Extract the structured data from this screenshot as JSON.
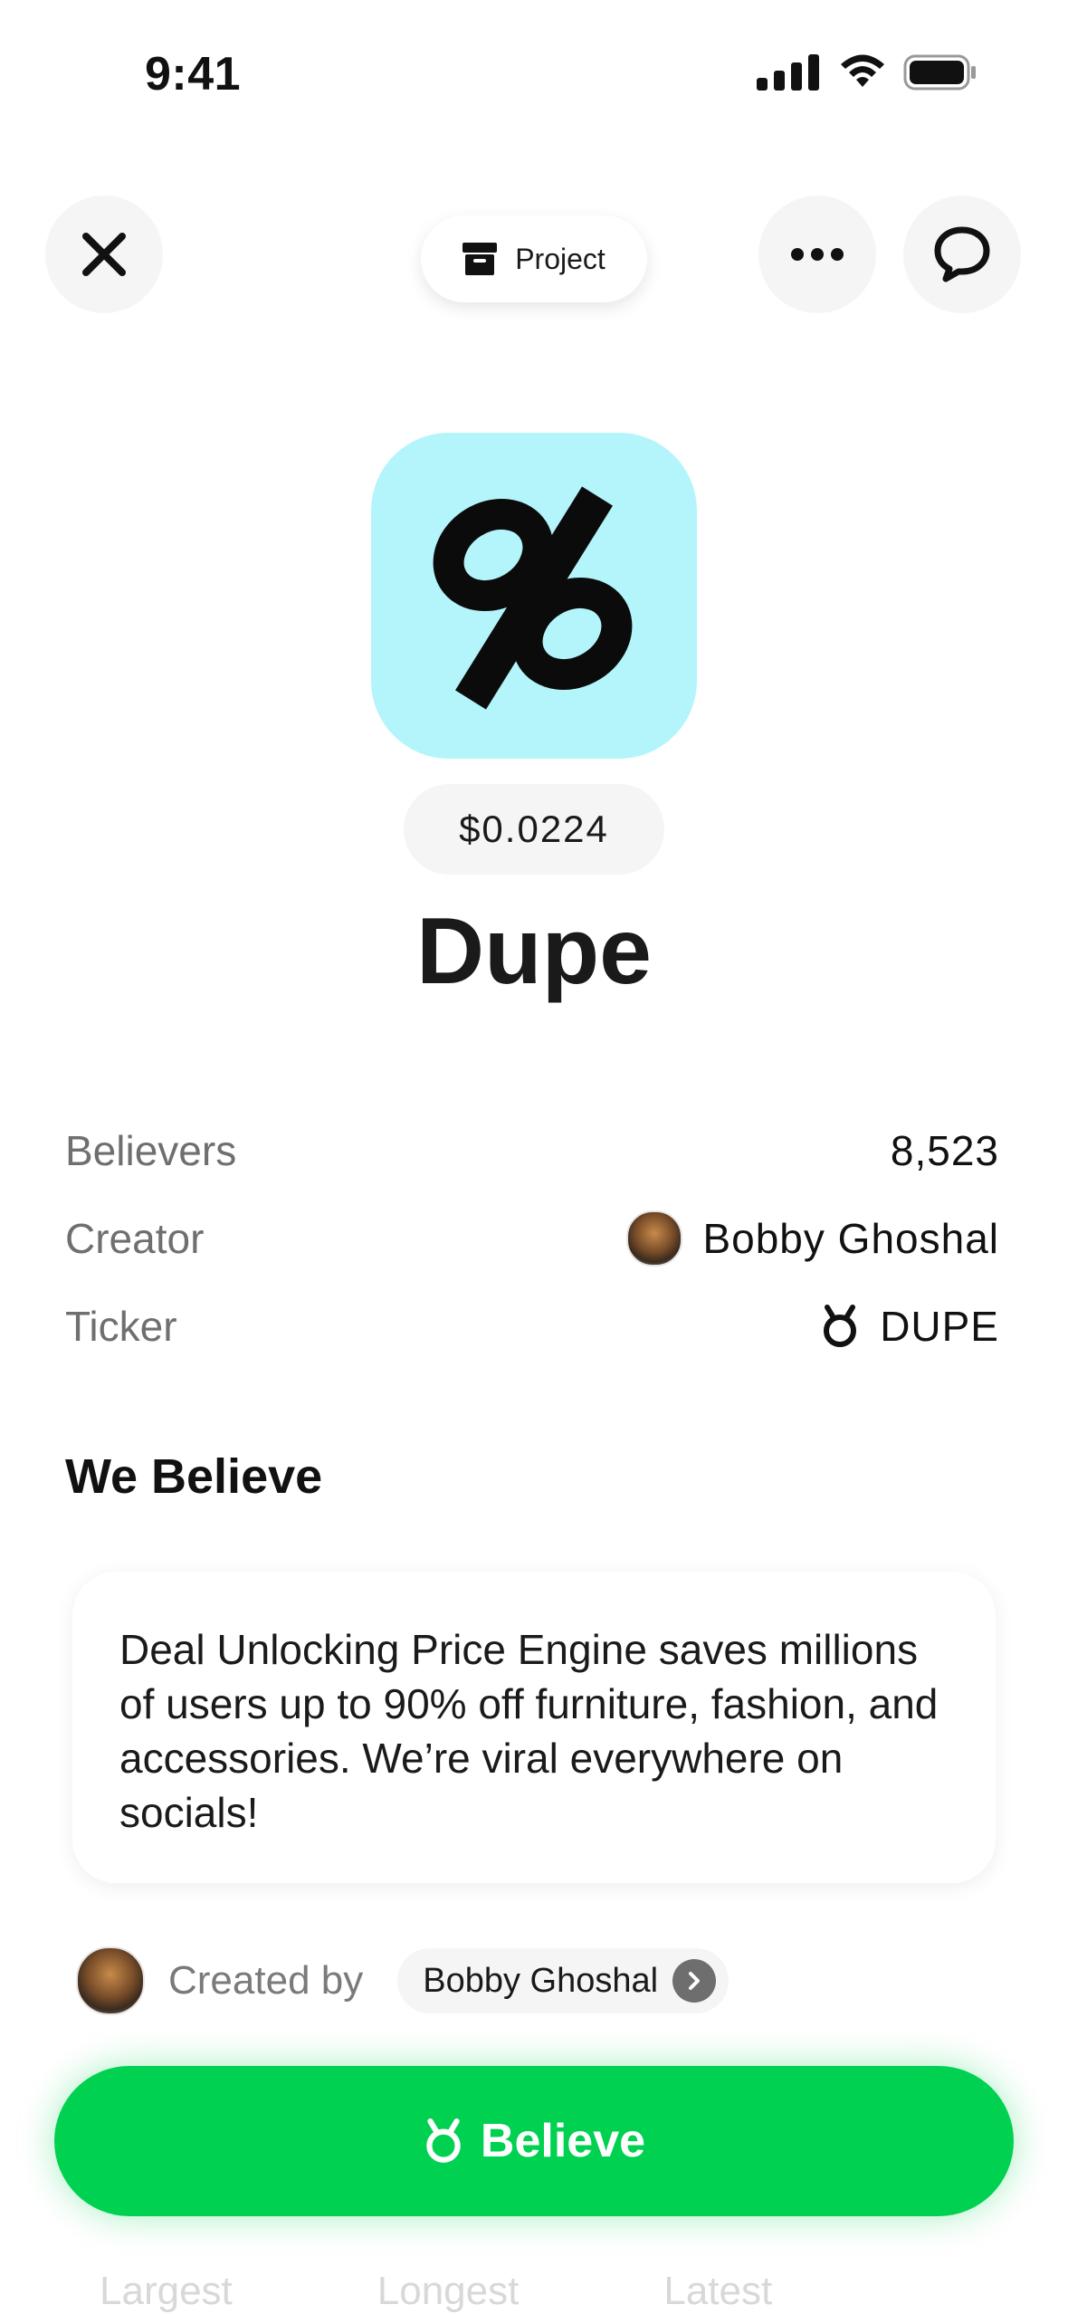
{
  "status_bar": {
    "time": "9:41"
  },
  "header": {
    "chip_label": "Project"
  },
  "project": {
    "price": "$0.0224",
    "name": "Dupe",
    "details": {
      "believers_label": "Believers",
      "believers_value": "8,523",
      "creator_label": "Creator",
      "creator_value": "Bobby Ghoshal",
      "ticker_label": "Ticker",
      "ticker_value": "DUPE"
    }
  },
  "belief": {
    "section_title": "We Believe",
    "text": "Deal Unlocking Price Engine saves millions of users up to 90% off furniture, fashion, and accessories. We’re viral everywhere on socials!",
    "created_by_label": "Created by",
    "creator_name": "Bobby Ghoshal"
  },
  "cta": {
    "believe_label": "Believe"
  },
  "tabs": [
    "Largest",
    "Longest",
    "Latest"
  ],
  "colors": {
    "accent_green": "#00d150",
    "icon_bg": "#b3f5fb",
    "chip_bg": "#f5f5f5"
  },
  "icons": {
    "close": "close-icon",
    "more": "more-icon",
    "chat": "chat-bubble-icon",
    "project": "archive-box-icon",
    "ticker": "believe-token-icon"
  }
}
